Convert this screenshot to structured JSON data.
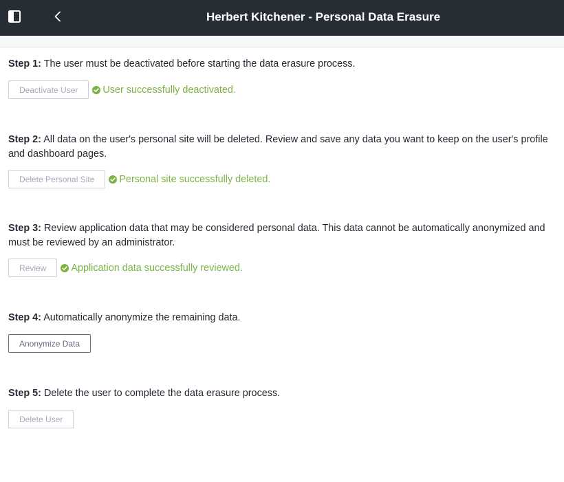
{
  "header": {
    "title": "Herbert Kitchener - Personal Data Erasure",
    "sidebar_toggle_icon": "sidebar-panel-icon",
    "back_icon": "chevron-left-icon"
  },
  "colors": {
    "topbar": "#272d35",
    "success": "#7cb342",
    "disabled_text": "#a7a9bc",
    "active_text": "#6b6c7e"
  },
  "steps": [
    {
      "label": "Step 1:",
      "text": " The user must be deactivated before starting the data erasure process.",
      "button": "Deactivate User",
      "button_enabled": false,
      "status": "User successfully deactivated."
    },
    {
      "label": "Step 2:",
      "text": " All data on the user's personal site will be deleted. Review and save any data you want to keep on the user's profile and dashboard pages.",
      "button": "Delete Personal Site",
      "button_enabled": false,
      "status": "Personal site successfully deleted."
    },
    {
      "label": "Step 3:",
      "text": " Review application data that may be considered personal data. This data cannot be automatically anonymized and must be reviewed by an administrator.",
      "button": "Review",
      "button_enabled": false,
      "status": "Application data successfully reviewed."
    },
    {
      "label": "Step 4:",
      "text": " Automatically anonymize the remaining data.",
      "button": "Anonymize Data",
      "button_enabled": true,
      "status": ""
    },
    {
      "label": "Step 5:",
      "text": " Delete the user to complete the data erasure process.",
      "button": "Delete User",
      "button_enabled": false,
      "status": ""
    }
  ]
}
